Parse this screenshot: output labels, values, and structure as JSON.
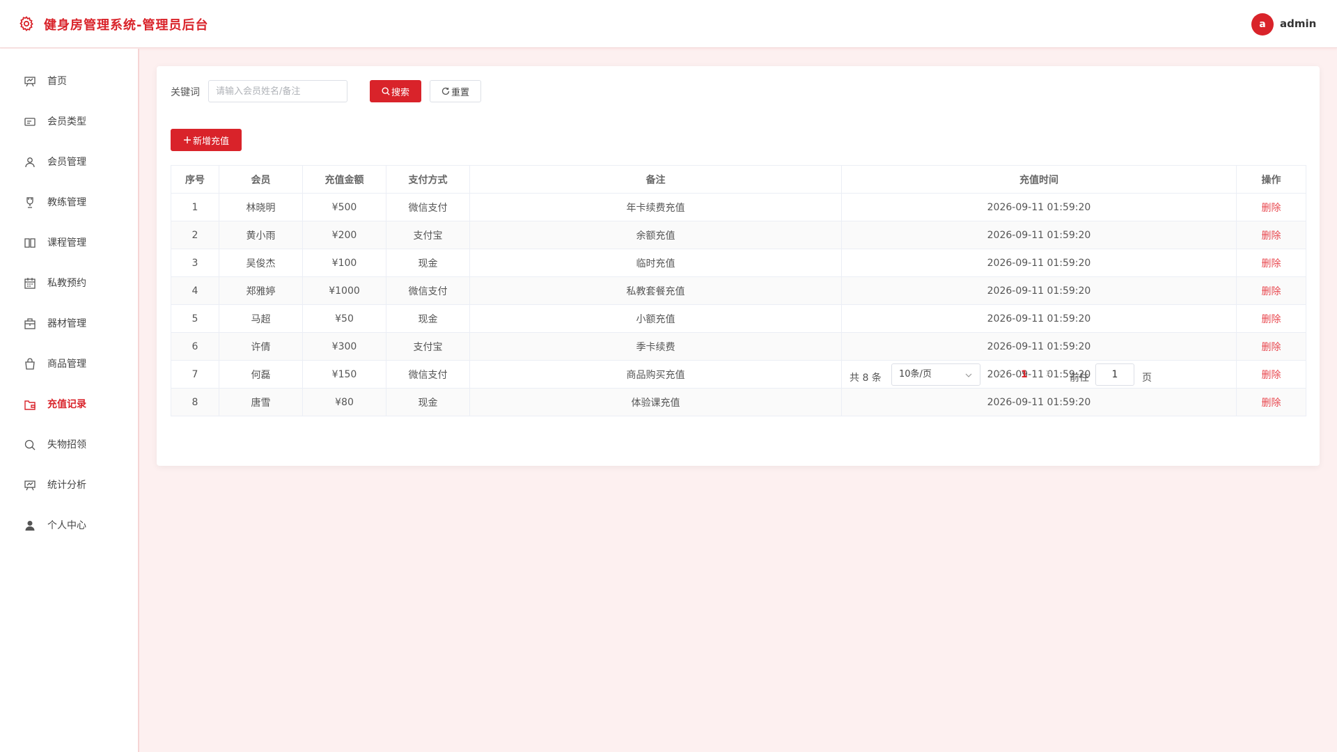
{
  "header": {
    "title": "健身房管理系统-管理员后台",
    "avatar_letter": "a",
    "username": "admin"
  },
  "sidebar": {
    "items": [
      {
        "label": "首页",
        "icon": "dashboard-icon"
      },
      {
        "label": "会员类型",
        "icon": "card-icon"
      },
      {
        "label": "会员管理",
        "icon": "user-icon"
      },
      {
        "label": "教练管理",
        "icon": "trophy-icon"
      },
      {
        "label": "课程管理",
        "icon": "book-icon"
      },
      {
        "label": "私教预约",
        "icon": "calendar-icon"
      },
      {
        "label": "器材管理",
        "icon": "box-icon"
      },
      {
        "label": "商品管理",
        "icon": "bag-icon"
      },
      {
        "label": "充值记录",
        "icon": "wallet-icon",
        "active": true
      },
      {
        "label": "失物招领",
        "icon": "search-icon"
      },
      {
        "label": "统计分析",
        "icon": "chart-icon"
      },
      {
        "label": "个人中心",
        "icon": "person-icon"
      }
    ]
  },
  "filters": {
    "keyword_label": "关键词",
    "keyword_placeholder": "请输入会员姓名/备注",
    "keyword_value": "",
    "search_label": "搜索",
    "reset_label": "重置"
  },
  "toolbar": {
    "add_label": "新增充值"
  },
  "table": {
    "headers": [
      "序号",
      "会员",
      "充值金额",
      "支付方式",
      "备注",
      "充值时间",
      "操作"
    ],
    "rows": [
      [
        "1",
        "林晓明",
        "¥500",
        "微信支付",
        "年卡续费充值",
        "2026-09-11 01:59:20",
        "删除"
      ],
      [
        "2",
        "黄小雨",
        "¥200",
        "支付宝",
        "余额充值",
        "2026-09-11 01:59:20",
        "删除"
      ],
      [
        "3",
        "吴俊杰",
        "¥100",
        "现金",
        "临时充值",
        "2026-09-11 01:59:20",
        "删除"
      ],
      [
        "4",
        "郑雅婷",
        "¥1000",
        "微信支付",
        "私教套餐充值",
        "2026-09-11 01:59:20",
        "删除"
      ],
      [
        "5",
        "马超",
        "¥50",
        "现金",
        "小额充值",
        "2026-09-11 01:59:20",
        "删除"
      ],
      [
        "6",
        "许倩",
        "¥300",
        "支付宝",
        "季卡续费",
        "2026-09-11 01:59:20",
        "删除"
      ],
      [
        "7",
        "何磊",
        "¥150",
        "微信支付",
        "商品购买充值",
        "2026-09-11 01:59:20",
        "删除"
      ],
      [
        "8",
        "唐雪",
        "¥80",
        "现金",
        "体验课充值",
        "2026-09-11 01:59:20",
        "删除"
      ]
    ]
  },
  "pagination": {
    "total": "共 8 条",
    "page_size": "10条/页",
    "current_page": "1",
    "goto_label": "前往",
    "goto_value": "1",
    "page_unit": "页"
  },
  "colors": {
    "accent": "#d9232a",
    "background": "#fdf0f0"
  }
}
